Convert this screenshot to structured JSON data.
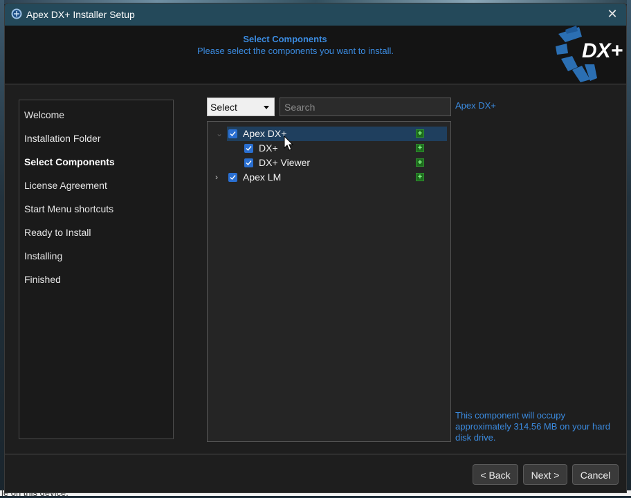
{
  "window": {
    "title": "Apex DX+ Installer Setup"
  },
  "header": {
    "title": "Select Components",
    "subtitle": "Please select the components you want to install.",
    "logo_text": "DX+"
  },
  "steps": [
    {
      "label": "Welcome",
      "active": false
    },
    {
      "label": "Installation Folder",
      "active": false
    },
    {
      "label": "Select Components",
      "active": true
    },
    {
      "label": "License Agreement",
      "active": false
    },
    {
      "label": "Start Menu shortcuts",
      "active": false
    },
    {
      "label": "Ready to Install",
      "active": false
    },
    {
      "label": "Installing",
      "active": false
    },
    {
      "label": "Finished",
      "active": false
    }
  ],
  "toolbar": {
    "select_label": "Select",
    "search_placeholder": "Search"
  },
  "tree": [
    {
      "label": "Apex DX+",
      "checked": true,
      "expanded": true,
      "selected": true
    },
    {
      "label": "DX+",
      "checked": true
    },
    {
      "label": "DX+ Viewer",
      "checked": true
    },
    {
      "label": "Apex LM",
      "checked": true,
      "expanded": false
    }
  ],
  "description": {
    "title": "Apex DX+",
    "space": "This component will occupy approximately 314.56 MB on your hard disk drive."
  },
  "buttons": {
    "back": "< Back",
    "next": "Next >",
    "cancel": "Cancel"
  },
  "background_text": "le on this device.",
  "colors": {
    "accent": "#3b8be0",
    "titlebar": "#24495a",
    "checkbox": "#2a6fd1",
    "selected_row": "#1f3f5e"
  }
}
